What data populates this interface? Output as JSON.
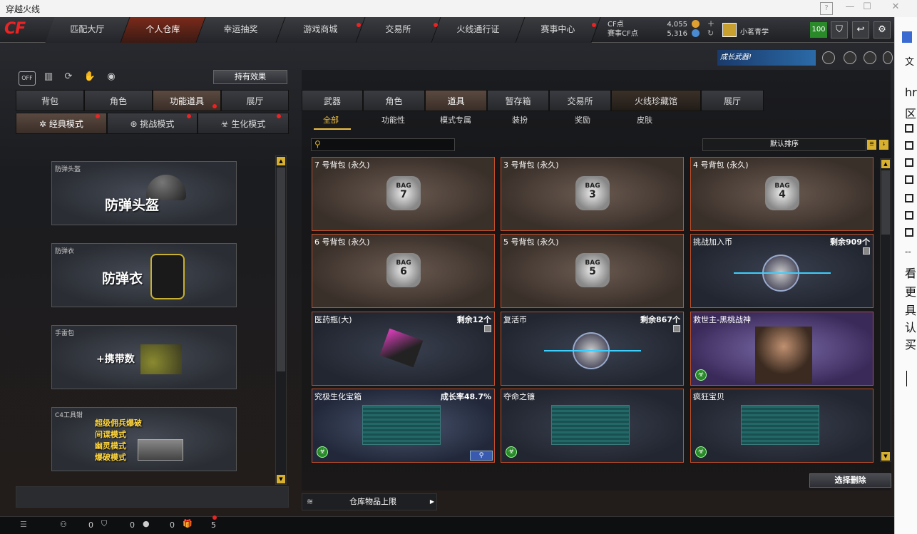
{
  "window": {
    "title": "穿越火线"
  },
  "nav": {
    "logo": "CF",
    "tabs": [
      "匹配大厅",
      "个人仓库",
      "幸运抽奖",
      "游戏商城",
      "交易所",
      "火线通行证",
      "赛事中心"
    ],
    "active": 1
  },
  "currency": {
    "cf_label": "CF点",
    "cf_value": "4,055",
    "event_label": "赛事CF点",
    "event_value": "5,316"
  },
  "user": {
    "name": "小茗青学",
    "level": "100"
  },
  "banner": {
    "text": "成长武器!"
  },
  "left": {
    "off_label": "OFF",
    "effects_button": "持有效果",
    "tabs": [
      "背包",
      "角色",
      "功能道具",
      "展厅"
    ],
    "active_tab": 2,
    "modes": [
      "经典模式",
      "挑战模式",
      "生化模式"
    ],
    "cards": [
      {
        "label": "防弹头盔",
        "big": "防弹头盔"
      },
      {
        "label": "防弹衣",
        "big": "防弹衣"
      },
      {
        "label": "手雷包",
        "big": "+携带数"
      },
      {
        "label": "C4工具钳",
        "big": "超级佣兵爆破\n间谍模式\n幽灵模式\n爆破模式"
      }
    ]
  },
  "right": {
    "tabs": [
      "武器",
      "角色",
      "道具",
      "暂存箱",
      "交易所",
      "火线珍藏馆",
      "展厅"
    ],
    "active_tab": 2,
    "subtabs": [
      "全部",
      "功能性",
      "模式专属",
      "装扮",
      "奖励",
      "皮肤"
    ],
    "active_subtab": 0,
    "search_placeholder": "",
    "sort_label": "默认排序",
    "items": [
      {
        "name": "7 号背包 (永久)",
        "remain": "",
        "icon": "7",
        "bag_text": "BAG"
      },
      {
        "name": "3 号背包 (永久)",
        "remain": "",
        "icon": "3",
        "bag_text": "BAG"
      },
      {
        "name": "4 号背包 (永久)",
        "remain": "",
        "icon": "4",
        "bag_text": "BAG"
      },
      {
        "name": "6 号背包 (永久)",
        "remain": "",
        "icon": "6",
        "bag_text": "BAG"
      },
      {
        "name": "5 号背包 (永久)",
        "remain": "",
        "icon": "5",
        "bag_text": "BAG"
      },
      {
        "name": "挑战加入币",
        "remain": "剩余909个",
        "icon": "",
        "bag_text": ""
      },
      {
        "name": "医药瓶(大)",
        "remain": "剩余12个",
        "icon": "",
        "bag_text": ""
      },
      {
        "name": "复活币",
        "remain": "剩余867个",
        "icon": "",
        "bag_text": ""
      },
      {
        "name": "救世主-黑桃战神",
        "remain": "",
        "icon": "",
        "bag_text": ""
      },
      {
        "name": "究极生化宝箱",
        "remain": "成长率48.7%",
        "icon": "",
        "bag_text": ""
      },
      {
        "name": "夺命之镰",
        "remain": "",
        "icon": "",
        "bag_text": ""
      },
      {
        "name": "疯狂宝贝",
        "remain": "",
        "icon": "",
        "bag_text": ""
      }
    ],
    "delete_button": "选择删除",
    "limit_label": "仓库物品上限"
  },
  "status": {
    "c1": "0",
    "c2": "0",
    "c3": "0",
    "c4": "5"
  },
  "sidebar_glyphs": [
    "文",
    "hr",
    "区",
    "看",
    "更",
    "具",
    "认",
    "买"
  ]
}
